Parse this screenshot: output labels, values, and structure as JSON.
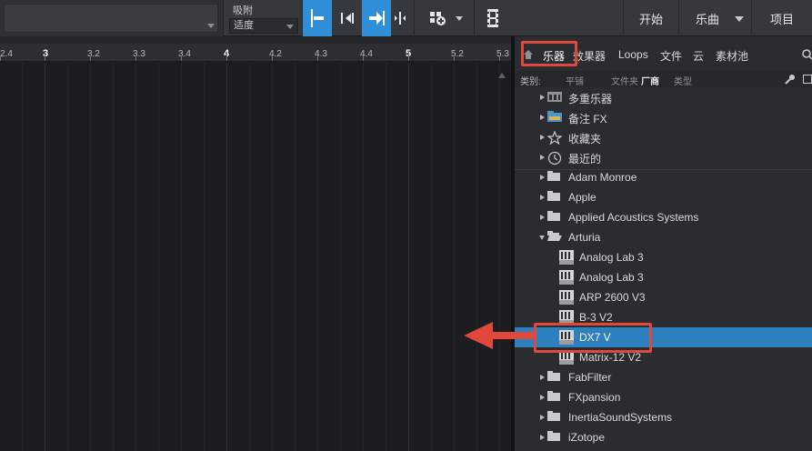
{
  "toolbar": {
    "snap_label": "吸附",
    "snap_value": "适度",
    "nav_start": "开始",
    "nav_song": "乐曲",
    "nav_project": "项目"
  },
  "ruler": {
    "labels": [
      "2.4",
      "3",
      "3.2",
      "3.3",
      "3.4",
      "4",
      "4.2",
      "4.3",
      "4.4",
      "5",
      "5.2",
      "5.3"
    ]
  },
  "browser": {
    "tabs": [
      "乐器",
      "效果器",
      "Loops",
      "文件",
      "云",
      "素材池"
    ],
    "filter": {
      "label": "类别:",
      "options": [
        "平铺",
        "文件夹",
        "厂商",
        "类型"
      ],
      "active": "厂商"
    },
    "special_folders": [
      "多重乐器",
      "备注 FX",
      "收藏夹",
      "最近的"
    ],
    "vendors": [
      {
        "name": "Adam Monroe"
      },
      {
        "name": "Apple"
      },
      {
        "name": "Applied Acoustics Systems"
      },
      {
        "name": "Arturia",
        "expanded": true,
        "plugins": [
          "Analog Lab 3",
          "Analog Lab 3",
          "ARP 2600 V3",
          "B-3 V2",
          "DX7 V",
          "Matrix-12 V2"
        ]
      },
      {
        "name": "FabFilter"
      },
      {
        "name": "FXpansion"
      },
      {
        "name": "InertiaSoundSystems"
      },
      {
        "name": "iZotope"
      }
    ],
    "selected_plugin": "DX7 V"
  },
  "colors": {
    "accent": "#2f8fd8",
    "selection": "#2e7fbe",
    "highlight": "#e0483c"
  },
  "icons": [
    "home-icon",
    "search-icon",
    "wrench-icon",
    "list-view-icon",
    "folder-icon",
    "star-icon",
    "clock-icon",
    "plugin-icon"
  ]
}
